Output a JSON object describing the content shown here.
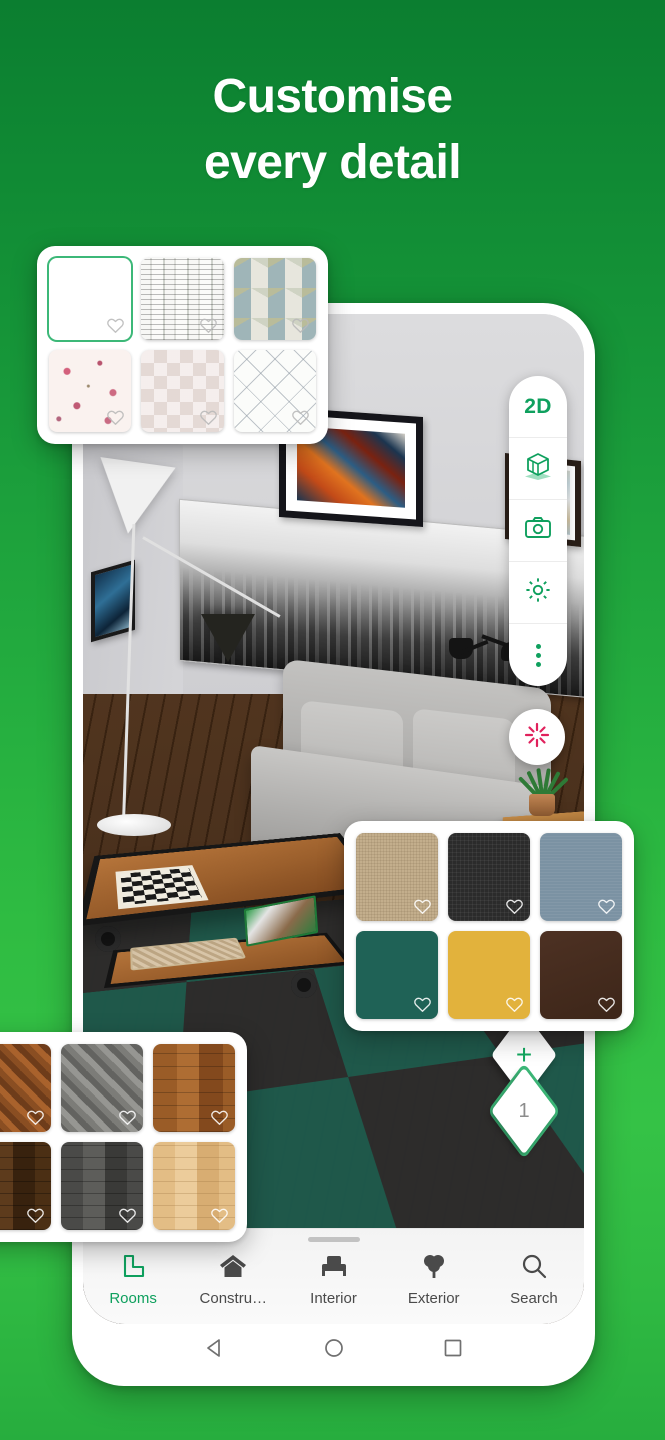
{
  "headline": {
    "line1": "Customise",
    "line2": "every detail"
  },
  "theme": {
    "background_green_top": "#0b7e30",
    "background_green_bottom": "#27ad3e",
    "accent_green": "#0fa05e",
    "magic_pink": "#e0215c"
  },
  "toolbar": {
    "items": [
      {
        "label": "2D",
        "icon": "2d-text-icon"
      },
      {
        "label": "",
        "icon": "3d-cube-icon"
      },
      {
        "label": "",
        "icon": "camera-icon"
      },
      {
        "label": "",
        "icon": "gear-icon"
      },
      {
        "label": "",
        "icon": "more-vertical-icon"
      }
    ]
  },
  "magic_button": {
    "icon": "sparkle-burst-icon"
  },
  "levels": {
    "add_label": "+",
    "current_label": "1"
  },
  "bottom_nav": {
    "items": [
      {
        "label": "Rooms",
        "icon": "room-plan-icon",
        "active": true
      },
      {
        "label": "Constru…",
        "icon": "house-icon",
        "active": false
      },
      {
        "label": "Interior",
        "icon": "sofa-icon",
        "active": false
      },
      {
        "label": "Exterior",
        "icon": "tree-icon",
        "active": false
      },
      {
        "label": "Search",
        "icon": "search-icon",
        "active": false
      }
    ]
  },
  "android_nav": {
    "back": "back-triangle-icon",
    "home": "home-circle-icon",
    "recents": "recents-square-icon"
  },
  "panels": {
    "wallpaper": {
      "name": "wallpaper-materials",
      "swatches": [
        {
          "name": "plain-white",
          "texture": "tx-white",
          "selected": true,
          "favourite": false
        },
        {
          "name": "birch-forest",
          "texture": "tx-birch",
          "selected": false,
          "favourite": false
        },
        {
          "name": "geometric-triangles",
          "texture": "tx-geo",
          "selected": false,
          "favourite": false
        },
        {
          "name": "pink-floral",
          "texture": "tx-floral",
          "selected": false,
          "favourite": false
        },
        {
          "name": "pale-patchwork",
          "texture": "tx-patch",
          "selected": false,
          "favourite": false
        },
        {
          "name": "diamond-lattice",
          "texture": "tx-lattice",
          "selected": false,
          "favourite": false
        }
      ]
    },
    "fabric": {
      "name": "upholstery-materials",
      "swatches": [
        {
          "name": "beige-linen",
          "texture": "tx-linen",
          "color": "#c3ae8c",
          "selected": false,
          "favourite": false
        },
        {
          "name": "charcoal-weave",
          "texture": "tx-charcoal",
          "color": "#2b2b2b",
          "selected": false,
          "favourite": false
        },
        {
          "name": "slate-blue",
          "texture": "tx-slate",
          "color": "#7b92a3",
          "selected": false,
          "favourite": false
        },
        {
          "name": "dark-teal",
          "texture": "tx-teal",
          "color": "#1f6256",
          "selected": false,
          "favourite": false
        },
        {
          "name": "mustard-yellow",
          "texture": "tx-mustard",
          "color": "#e2b23c",
          "selected": false,
          "favourite": false
        },
        {
          "name": "dark-brown",
          "texture": "tx-brown",
          "color": "#3d2619",
          "selected": false,
          "favourite": false
        }
      ]
    },
    "floor": {
      "name": "flooring-materials",
      "swatches": [
        {
          "name": "brown-herringbone",
          "texture": "tx-herring-brown",
          "selected": false,
          "favourite": false
        },
        {
          "name": "grey-herringbone",
          "texture": "tx-herring-grey",
          "selected": false,
          "favourite": false
        },
        {
          "name": "medium-oak-plank",
          "texture": "tx-oak",
          "selected": false,
          "favourite": false
        },
        {
          "name": "dark-walnut-plank",
          "texture": "tx-walnut",
          "selected": false,
          "favourite": false
        },
        {
          "name": "grey-plank",
          "texture": "tx-greyplank",
          "selected": false,
          "favourite": false
        },
        {
          "name": "light-maple-plank",
          "texture": "tx-maple",
          "selected": false,
          "favourite": false
        }
      ]
    }
  },
  "scene": {
    "description": "3D living room render",
    "objects": [
      "grey-sofa",
      "industrial-coffee-table",
      "chess-board",
      "magazine",
      "arc-floor-lamp",
      "black-pendant-shade",
      "wall-lamp",
      "abstract-wall-art",
      "small-framed-art",
      "cityscape-panorama",
      "blue-abstract-art",
      "side-table",
      "potted-plant",
      "teal-checkered-rug",
      "dark-wood-floor"
    ]
  }
}
